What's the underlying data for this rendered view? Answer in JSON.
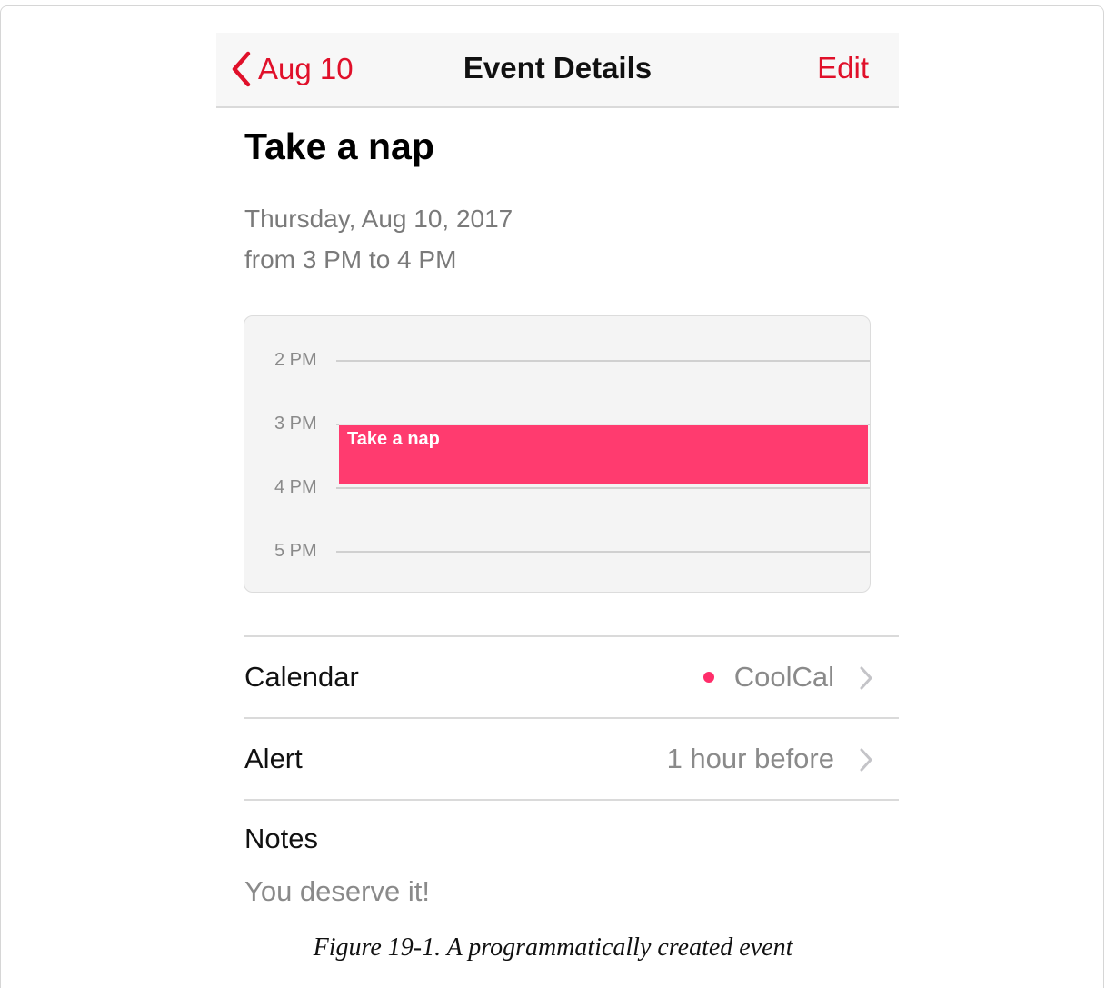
{
  "navbar": {
    "back_label": "Aug 10",
    "title": "Event Details",
    "edit_label": "Edit"
  },
  "event": {
    "title": "Take a nap",
    "date": "Thursday, Aug 10, 2017",
    "time": "from 3 PM to 4 PM"
  },
  "timeline": {
    "hours": [
      "2 PM",
      "3 PM",
      "4 PM",
      "5 PM"
    ],
    "event_label": "Take a nap",
    "event_color": "#ff3b6f"
  },
  "details": {
    "calendar_label": "Calendar",
    "calendar_value": "CoolCal",
    "calendar_color": "#ff2d6a",
    "alert_label": "Alert",
    "alert_value": "1 hour before",
    "notes_label": "Notes",
    "notes_text": "You deserve it!"
  },
  "icons": {
    "back": "chevron-left-icon",
    "disclosure": "chevron-right-icon"
  },
  "accent_color": "#e0102a",
  "caption": "Figure 19-1. A programmatically created event"
}
